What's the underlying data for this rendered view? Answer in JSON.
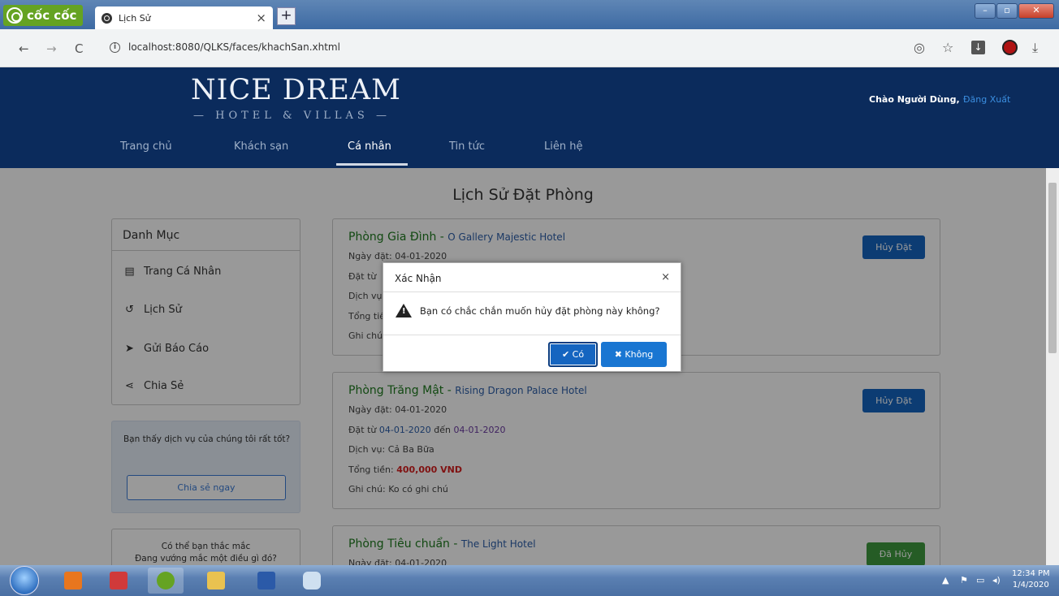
{
  "browser": {
    "brand": "cốc cốc",
    "tab_title": "Lịch Sử",
    "tab_close": "×",
    "new_tab": "+",
    "url": "localhost:8080/QLKS/faces/khachSan.xhtml"
  },
  "header": {
    "logo_main": "NICE DREAM",
    "logo_sub": "— HOTEL & VILLAS —",
    "greeting": "Chào Người Dùng,",
    "logout": "Đăng Xuất",
    "menu": [
      "Trang chủ",
      "Khách sạn",
      "Cá nhân",
      "Tin tức",
      "Liên hệ"
    ]
  },
  "main": {
    "page_title": "Lịch Sử Đặt Phòng",
    "sidebar": {
      "heading": "Danh Mục",
      "items": [
        {
          "label": "Trang Cá Nhân",
          "icon": "id-card-icon"
        },
        {
          "label": "Lịch Sử",
          "icon": "history-icon"
        },
        {
          "label": "Gửi Báo Cáo",
          "icon": "send-icon"
        },
        {
          "label": "Chia Sẻ",
          "icon": "share-icon"
        }
      ]
    },
    "promo": {
      "text": "Bạn thấy dịch vụ của chúng tôi rất tốt?",
      "button": "Chia sẻ ngay"
    },
    "faq": {
      "line1": "Có thể bạn thắc mắc",
      "line2": "Đang vướng mắc một điều gì đó?"
    },
    "bookings": [
      {
        "room": "Phòng Gia Đình",
        "sep": " - ",
        "hotel": "O Gallery Majestic Hotel",
        "booked_date": "Ngày đặt: 04-01-2020",
        "range_label": "Đặt từ",
        "service_label": "Dịch vụ",
        "total_label": "Tổng tiền",
        "note_label": "Ghi chú",
        "button": "Hủy Đặt"
      },
      {
        "room": "Phòng Trăng Mật",
        "sep": " - ",
        "hotel": "Rising Dragon Palace Hotel",
        "booked_date": "Ngày đặt: 04-01-2020",
        "range_prefix": "Đặt từ ",
        "range_from": "04-01-2020",
        "range_mid": " đến ",
        "range_to": "04-01-2020",
        "service": "Dịch vụ: Cả Ba Bữa",
        "total_prefix": "Tổng tiền: ",
        "total": "400,000 VND",
        "note": "Ghi chú: Ko có ghi chú",
        "button": "Hủy Đặt"
      },
      {
        "room": "Phòng Tiêu chuẩn",
        "sep": " - ",
        "hotel": "The Light Hotel",
        "booked_date": "Ngày đặt: 04-01-2020",
        "button": "Đã Hủy"
      }
    ]
  },
  "dialog": {
    "title": "Xác Nhận",
    "close": "×",
    "message": "Bạn có chắc chắn muốn hủy đặt phòng này không?",
    "yes": "✔ Có",
    "no": "✖ Không"
  },
  "taskbar": {
    "time": "12:34 PM",
    "date": "1/4/2020"
  },
  "colors": {
    "header_bg": "#0b2b5c",
    "primary_button": "#1565c0",
    "cancelled_button": "#3f9a3f",
    "room_title": "#1f7a1f",
    "price": "#d61f1f"
  }
}
